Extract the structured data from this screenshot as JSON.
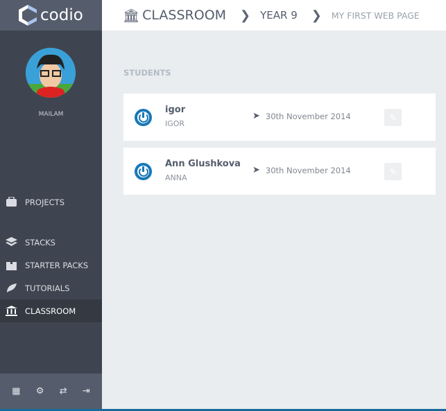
{
  "brand": {
    "name": "codio"
  },
  "user": {
    "name": "MAILAM"
  },
  "sidebar": {
    "items": [
      {
        "label": "PROJECTS",
        "icon": "briefcase-icon"
      },
      {
        "label": "STACKS",
        "icon": "layers-icon"
      },
      {
        "label": "STARTER PACKS",
        "icon": "box-icon"
      },
      {
        "label": "TUTORIALS",
        "icon": "feather-icon"
      },
      {
        "label": "CLASSROOM",
        "icon": "bank-icon",
        "active": true
      }
    ],
    "bottom_icons": [
      "building-icon",
      "gear-icon",
      "signpost-icon",
      "logout-icon"
    ]
  },
  "breadcrumb": [
    "CLASSROOM",
    "YEAR 9",
    "MY FIRST WEB PAGE"
  ],
  "main": {
    "title": "STUDENTS",
    "students": [
      {
        "name": "igor",
        "login": "IGOR",
        "date": "30th November 2014"
      },
      {
        "name": "Ann Glushkova",
        "login": "ANNA",
        "date": "30th November 2014"
      }
    ]
  },
  "colors": {
    "accent": "#1778b7",
    "sidebar": "#3f4550",
    "header_dark": "#555d6c"
  }
}
